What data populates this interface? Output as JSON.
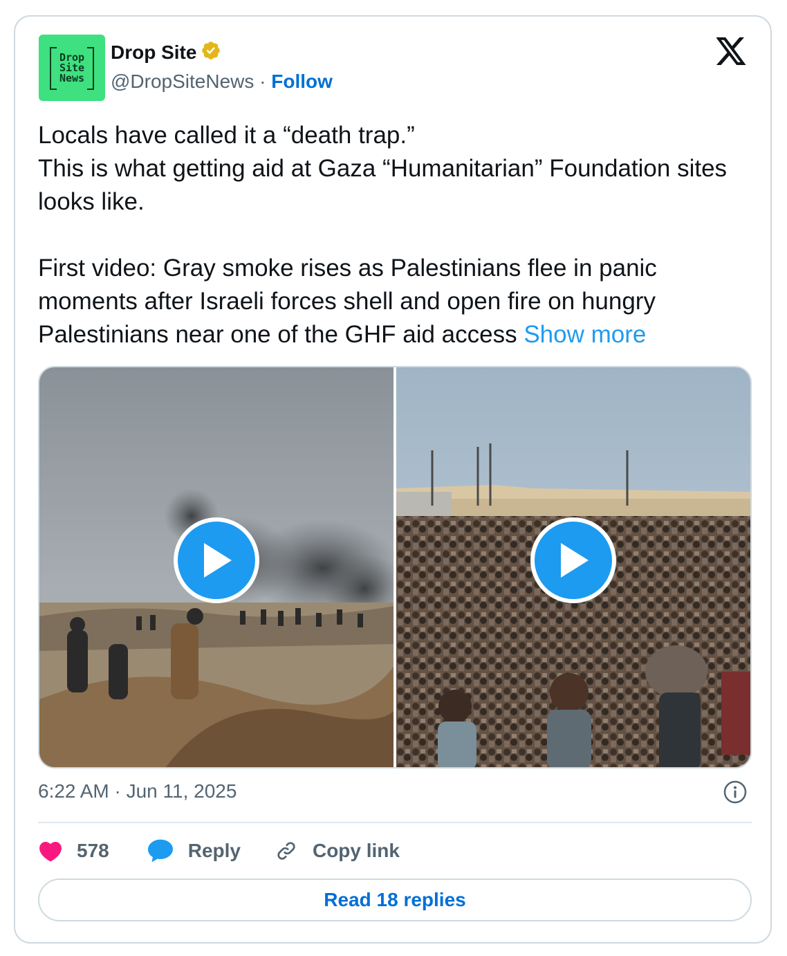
{
  "author": {
    "name": "Drop Site",
    "handle": "@DropSiteNews",
    "separator": "·",
    "follow_label": "Follow",
    "avatar_text": "Drop\nSite\nNews",
    "verified_icon": "verified-badge-icon"
  },
  "platform_icon": "x-logo-icon",
  "tweet": {
    "line1": "Locals have called it a “death trap.”",
    "line2": "This is what getting aid at Gaza “Humanitarian” Foundation sites looks like.",
    "para2": "First video: Gray smoke rises as Palestinians flee in panic moments after Israeli forces shell and open fire on hungry Palestinians near one of the GHF aid access ",
    "show_more": "Show more"
  },
  "media": [
    {
      "type": "video",
      "icon": "play-icon"
    },
    {
      "type": "video",
      "icon": "play-icon"
    }
  ],
  "timestamp": "6:22 AM · Jun 11, 2025",
  "actions": {
    "likes": "578",
    "reply_label": "Reply",
    "copy_label": "Copy link"
  },
  "read_replies_label": "Read 18 replies",
  "colors": {
    "accent": "#1d9bf0",
    "link": "#006fd6",
    "heart": "#f91880",
    "avatar_bg": "#3ee07f",
    "verified": "#e2b719"
  }
}
